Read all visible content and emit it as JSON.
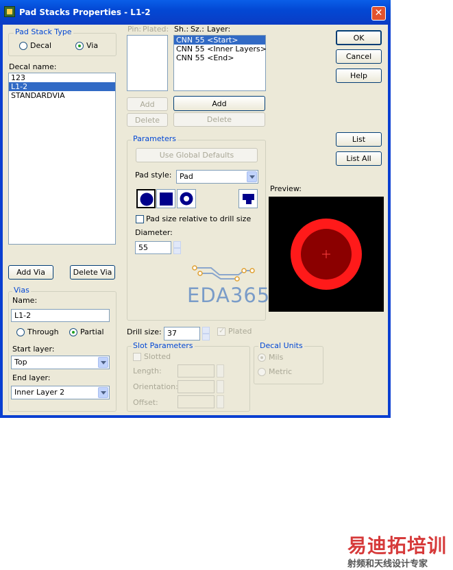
{
  "window": {
    "title": "Pad Stacks Properties - L1-2"
  },
  "pad_stack_type": {
    "legend": "Pad Stack Type",
    "options": [
      "Decal",
      "Via"
    ],
    "selected": "Via"
  },
  "decal_name": {
    "label": "Decal name:",
    "items": [
      "123",
      "L1-2",
      "STANDARDVIA"
    ],
    "selected": "L1-2"
  },
  "buttons": {
    "add_via": "Add Via",
    "delete_via": "Delete Via",
    "ok": "OK",
    "cancel": "Cancel",
    "help": "Help",
    "list": "List",
    "list_all": "List All",
    "pin_add": "Add",
    "pin_delete": "Delete",
    "layer_add": "Add",
    "layer_delete": "Delete",
    "use_global_defaults": "Use Global Defaults"
  },
  "vias": {
    "legend": "Vias",
    "name_label": "Name:",
    "name_value": "L1-2",
    "options": [
      "Through",
      "Partial"
    ],
    "selected": "Partial",
    "start_layer_label": "Start layer:",
    "start_layer_value": "Top",
    "end_layer_label": "End layer:",
    "end_layer_value": "Inner Layer 2"
  },
  "pins_header": {
    "pin": "Pin:",
    "plated": "Plated:"
  },
  "layers_header": {
    "sh": "Sh.:",
    "sz": "Sz.:",
    "layer": "Layer:"
  },
  "layers": [
    "CNN 55 <Start>",
    "CNN 55 <Inner Layers>",
    "CNN 55 <End>"
  ],
  "layers_selected": "CNN 55 <Start>",
  "parameters": {
    "legend": "Parameters",
    "pad_style_label": "Pad style:",
    "pad_style_value": "Pad",
    "relative_checkbox_label": "Pad size relative to drill size",
    "diameter_label": "Diameter:",
    "diameter_value": "55"
  },
  "drill": {
    "label": "Drill size:",
    "value": "37",
    "plated_label": "Plated"
  },
  "slot_parameters": {
    "legend": "Slot Parameters",
    "slotted_label": "Slotted",
    "length_label": "Length:",
    "orientation_label": "Orientation:",
    "offset_label": "Offset:"
  },
  "decal_units": {
    "legend": "Decal Units",
    "options": [
      "Mils",
      "Metric"
    ],
    "selected": "Mils"
  },
  "preview": {
    "label": "Preview:",
    "pad_color": "#ff1a1a",
    "drill_color": "#8b0000",
    "background": "#000000"
  },
  "watermark_eda": "EDA365",
  "footer_watermark": {
    "main": "易迪拓培训",
    "sub": "射频和天线设计专家"
  }
}
